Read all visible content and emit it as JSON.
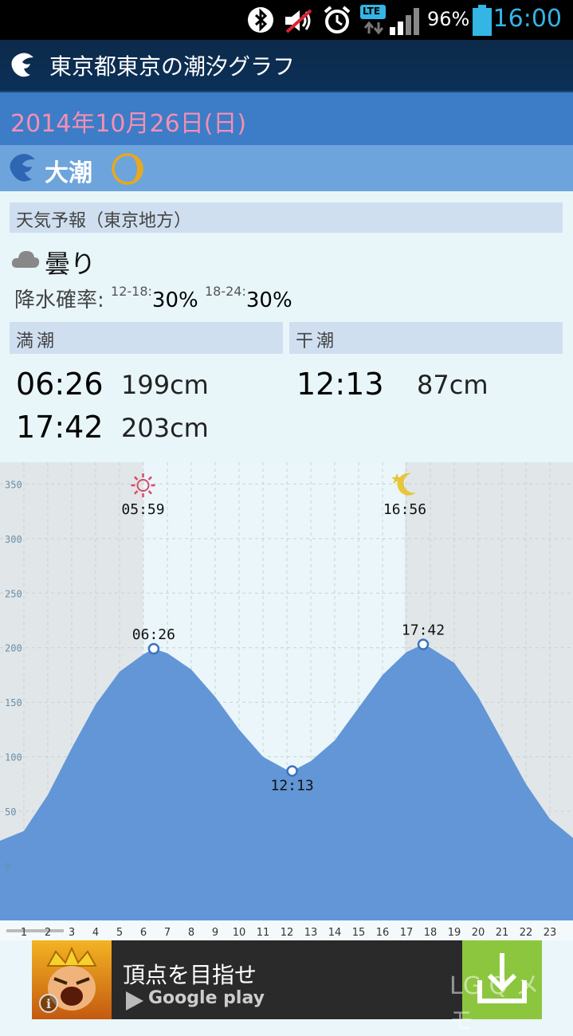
{
  "status_bar": {
    "battery": "96%",
    "time": "16:00",
    "network": "LTE",
    "icons": [
      "bluetooth-icon",
      "volume-muted-icon",
      "alarm-icon",
      "lte-icon",
      "signal-icon",
      "battery-icon"
    ]
  },
  "app_bar": {
    "title": "東京都東京の潮汐グラフ",
    "icon": "wave-logo-icon"
  },
  "date": "2014年10月26日(日)",
  "tide_type": {
    "label": "大潮",
    "moon_icon": "crescent-moon-icon"
  },
  "weather": {
    "header": "天気予報（東京地方）",
    "condition": "曇り",
    "condition_icon": "cloud-icon",
    "precip_label": "降水確率:",
    "precip": [
      {
        "range": "12-18:",
        "value": "30%"
      },
      {
        "range": "18-24:",
        "value": "30%"
      }
    ]
  },
  "high_tide": {
    "header": "満潮",
    "entries": [
      {
        "time": "06:26",
        "level": "199cm"
      },
      {
        "time": "17:42",
        "level": "203cm"
      }
    ]
  },
  "low_tide": {
    "header": "干潮",
    "entries": [
      {
        "time": "12:13",
        "level": "87cm"
      }
    ]
  },
  "colors": {
    "accent": "#3d7cc7",
    "date_text": "#f28fb4",
    "tide_fill": "#6296d6",
    "night_shade": "#e1e6e8",
    "day_bg": "#eaf6fa"
  },
  "chart_data": {
    "type": "area",
    "x": [
      0,
      1,
      2,
      3,
      4,
      5,
      6,
      6.43,
      7,
      8,
      9,
      10,
      11,
      12,
      12.22,
      13,
      14,
      15,
      16,
      17,
      17.7,
      18,
      19,
      20,
      21,
      22,
      23,
      24
    ],
    "y": [
      23,
      32,
      65,
      108,
      148,
      178,
      194,
      199,
      195,
      180,
      155,
      125,
      100,
      88,
      87,
      96,
      115,
      145,
      175,
      196,
      203,
      200,
      186,
      155,
      115,
      75,
      43,
      25
    ],
    "ylim": [
      -50,
      370
    ],
    "xlim": [
      0,
      24
    ],
    "y_ticks": [
      0,
      50,
      100,
      150,
      200,
      250,
      300,
      350
    ],
    "x_ticks": [
      1,
      2,
      3,
      4,
      5,
      6,
      7,
      8,
      9,
      10,
      11,
      12,
      13,
      14,
      15,
      16,
      17,
      18,
      19,
      20,
      21,
      22,
      23
    ],
    "sunrise": "05:59",
    "sunset": "16:56",
    "annotations": [
      {
        "x": 6.43,
        "y": 199,
        "label": "06:26",
        "position": "above"
      },
      {
        "x": 12.22,
        "y": 87,
        "label": "12:13",
        "position": "below"
      },
      {
        "x": 17.7,
        "y": 203,
        "label": "17:42",
        "position": "above"
      }
    ],
    "grid": true
  },
  "ad": {
    "title": "頂点を目指せ",
    "store": "Google play",
    "watermark": "LG Q メモ",
    "icons": [
      "game-app-icon",
      "info-icon",
      "play-store-icon",
      "download-icon"
    ]
  }
}
